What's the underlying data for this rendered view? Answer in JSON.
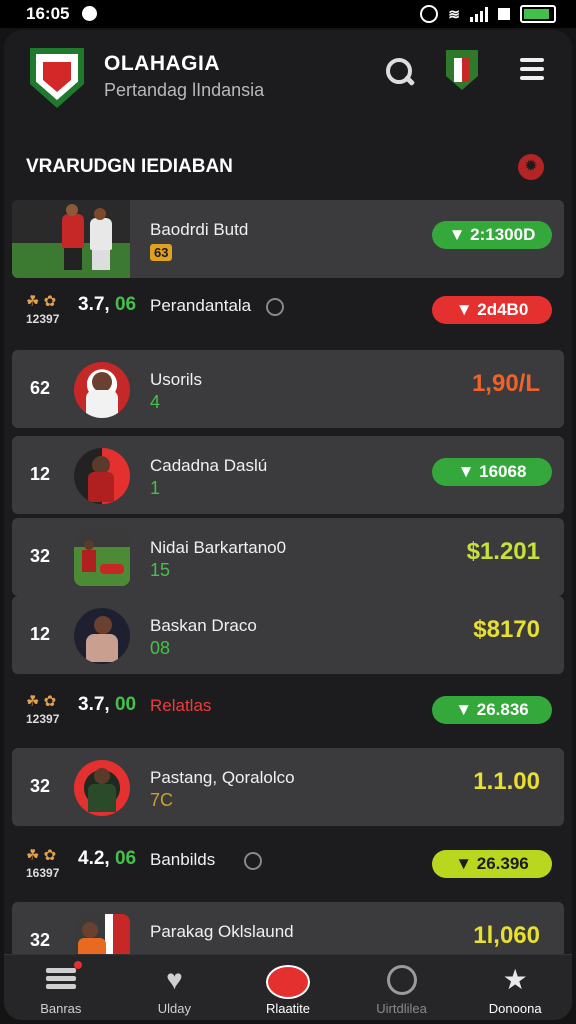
{
  "status": {
    "time": "16:05"
  },
  "header": {
    "title": "OLAHAGIA",
    "subtitle": "Pertandag lIndansia"
  },
  "section": {
    "title": "VRARUDGN IEDIABAN"
  },
  "featured": {
    "name": "Baodrdi Butd",
    "badge": "63",
    "pill": "▼ 2:1300D"
  },
  "group_rows": [
    {
      "icons": "☘ ✿",
      "small": "12397",
      "score_a": "3.7,",
      "score_b": "06",
      "label": "Perandantala",
      "pill": "▼ 2d4B0"
    },
    {
      "icons": "☘ ✿",
      "small": "12397",
      "score_a": "3.7,",
      "score_b": "00",
      "label": "Relatlas",
      "pill": "▼ 26.836"
    },
    {
      "icons": "☘ ✿",
      "small": "16397",
      "score_a": "4.2,",
      "score_b": "06",
      "label": "Banbilds",
      "pill": "▼ 26.396"
    }
  ],
  "players": [
    {
      "rank": "62",
      "name": "Usorils",
      "num": "4",
      "value": "1,90/L"
    },
    {
      "rank": "12",
      "name": "Cadadna Daslú",
      "num": "1",
      "pill": "▼ 16068"
    },
    {
      "rank": "32",
      "name": "Nidai Barkartano0",
      "num": "15",
      "value": "$1.201"
    },
    {
      "rank": "12",
      "name": "Baskan Draco",
      "num": "08",
      "value": "$8170"
    },
    {
      "rank": "32",
      "name": "Pastang, Qoralolco",
      "num": "7C",
      "value": "1.1.00"
    },
    {
      "rank": "32",
      "name": "Parakag Oklslaund",
      "num": "",
      "value": "1l,060"
    }
  ],
  "nav": [
    {
      "label": "Banras",
      "icon": "list-icon"
    },
    {
      "label": "Ulday",
      "icon": "heart-check-icon"
    },
    {
      "label": "Rlaatite",
      "icon": "ball-icon"
    },
    {
      "label": "Uirtdlilea",
      "icon": "clock-icon"
    },
    {
      "label": "Donoona",
      "icon": "trophy-icon"
    }
  ],
  "colors": {
    "accent_green": "#34a83b",
    "accent_red": "#e53030",
    "accent_lime": "#b9d71f",
    "value_orange": "#f0622a",
    "value_yellow": "#e8e030"
  }
}
